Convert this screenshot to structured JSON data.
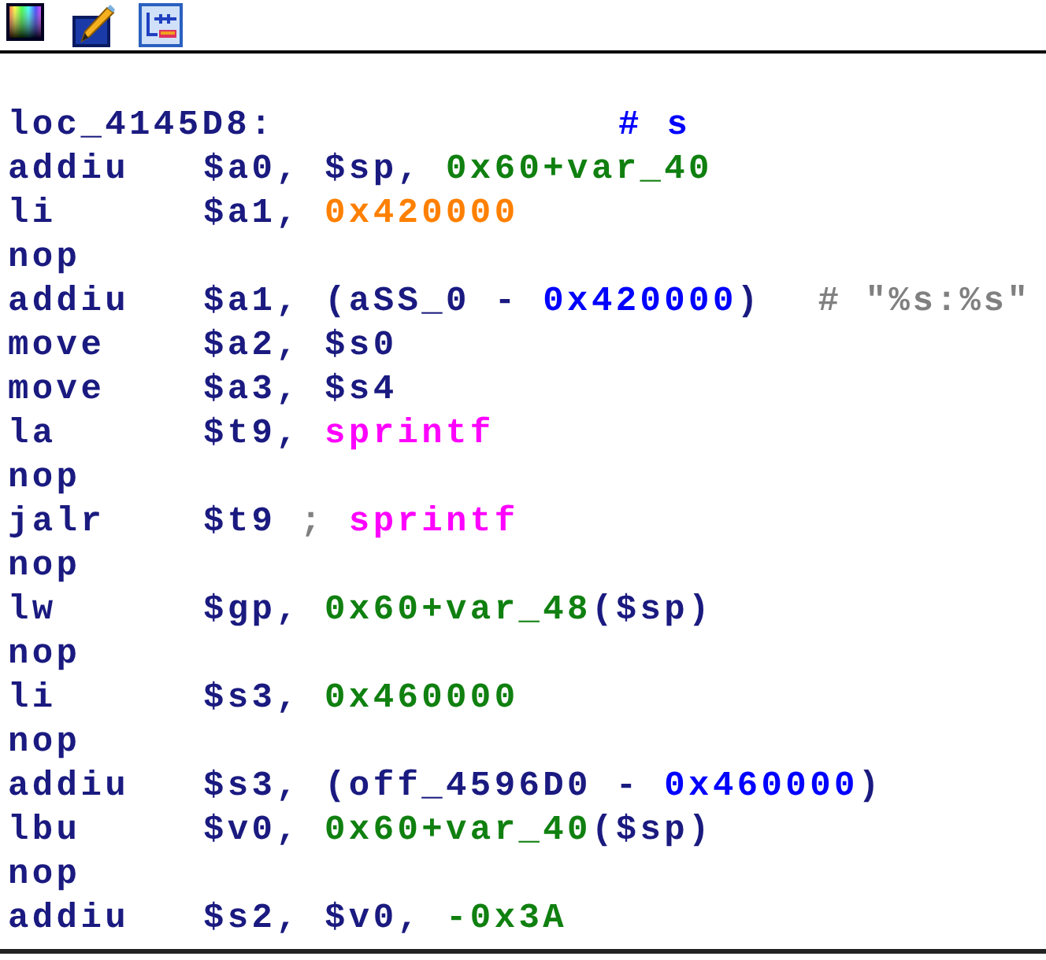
{
  "toolbar": {
    "buttons": [
      {
        "kind": "palette"
      },
      {
        "kind": "edit"
      },
      {
        "kind": "graph"
      }
    ]
  },
  "lines": [
    {
      "kind": "label",
      "label": "loc_4145D8:",
      "comment": {
        "text": "# s",
        "kind": "xref"
      }
    },
    {
      "kind": "instr",
      "mnemonic": "addiu",
      "operands": [
        {
          "text": "$a0, $sp, ",
          "kind": "reg"
        },
        {
          "text": "0x60+var_40",
          "kind": "num"
        }
      ]
    },
    {
      "kind": "instr",
      "mnemonic": "li",
      "operands": [
        {
          "text": "$a1, ",
          "kind": "reg"
        },
        {
          "text": "0x420000",
          "kind": "imm"
        }
      ]
    },
    {
      "kind": "instr",
      "mnemonic": "nop"
    },
    {
      "kind": "instr",
      "mnemonic": "addiu",
      "operands": [
        {
          "text": "$a1, (aSS_0 - ",
          "kind": "reg"
        },
        {
          "text": "0x420000",
          "kind": "offset"
        },
        {
          "text": ")",
          "kind": "reg"
        }
      ],
      "comment": {
        "text": "# \"%s:%s\"",
        "kind": "gray"
      }
    },
    {
      "kind": "instr",
      "mnemonic": "move",
      "operands": [
        {
          "text": "$a2, $s0",
          "kind": "reg"
        }
      ]
    },
    {
      "kind": "instr",
      "mnemonic": "move",
      "operands": [
        {
          "text": "$a3, $s4",
          "kind": "reg"
        }
      ]
    },
    {
      "kind": "instr",
      "mnemonic": "la",
      "operands": [
        {
          "text": "$t9, ",
          "kind": "reg"
        },
        {
          "text": "sprintf",
          "kind": "func"
        }
      ]
    },
    {
      "kind": "instr",
      "mnemonic": "nop"
    },
    {
      "kind": "instr",
      "mnemonic": "jalr",
      "operands": [
        {
          "text": "$t9 ",
          "kind": "reg"
        },
        {
          "text": "; ",
          "kind": "gray"
        },
        {
          "text": "sprintf",
          "kind": "func"
        }
      ]
    },
    {
      "kind": "instr",
      "mnemonic": "nop"
    },
    {
      "kind": "instr",
      "mnemonic": "lw",
      "operands": [
        {
          "text": "$gp, ",
          "kind": "reg"
        },
        {
          "text": "0x60+var_48",
          "kind": "num"
        },
        {
          "text": "($sp)",
          "kind": "reg"
        }
      ]
    },
    {
      "kind": "instr",
      "mnemonic": "nop"
    },
    {
      "kind": "instr",
      "mnemonic": "li",
      "operands": [
        {
          "text": "$s3, ",
          "kind": "reg"
        },
        {
          "text": "0x460000",
          "kind": "num"
        }
      ]
    },
    {
      "kind": "instr",
      "mnemonic": "nop"
    },
    {
      "kind": "instr",
      "mnemonic": "addiu",
      "operands": [
        {
          "text": "$s3, (off_4596D0 - ",
          "kind": "reg"
        },
        {
          "text": "0x460000",
          "kind": "offset"
        },
        {
          "text": ")",
          "kind": "reg"
        }
      ]
    },
    {
      "kind": "instr",
      "mnemonic": "lbu",
      "operands": [
        {
          "text": "$v0, ",
          "kind": "reg"
        },
        {
          "text": "0x60+var_40",
          "kind": "num"
        },
        {
          "text": "($sp)",
          "kind": "reg"
        }
      ]
    },
    {
      "kind": "instr",
      "mnemonic": "nop"
    },
    {
      "kind": "instr",
      "mnemonic": "addiu",
      "operands": [
        {
          "text": "$s2, $v0, ",
          "kind": "reg"
        },
        {
          "text": "-0x3A",
          "kind": "num"
        }
      ]
    }
  ]
}
